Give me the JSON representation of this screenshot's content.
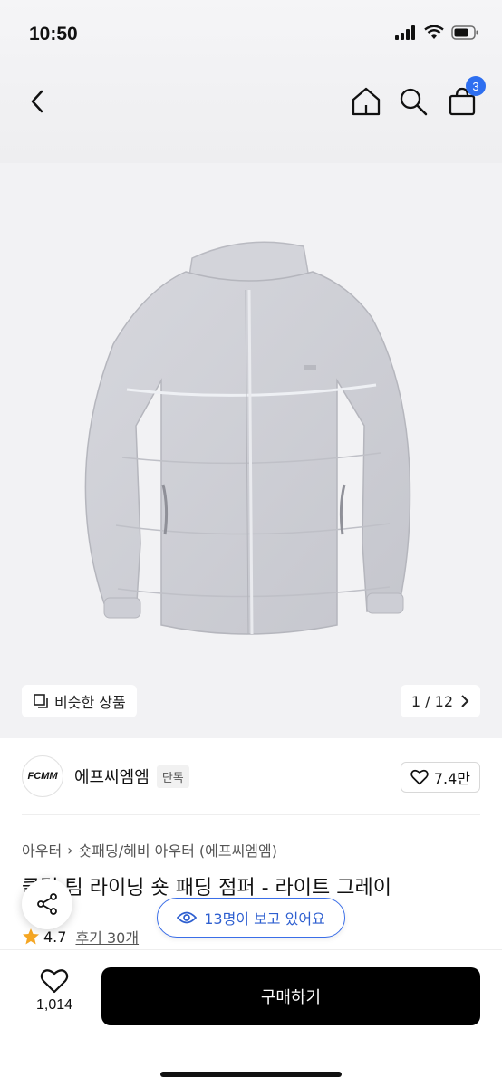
{
  "status": {
    "time": "10:50",
    "battery_icon": "battery-icon",
    "wifi_icon": "wifi-icon",
    "signal_icon": "signal-icon"
  },
  "nav": {
    "back_icon": "chevron-left-icon",
    "home_icon": "home-icon",
    "search_icon": "search-icon",
    "cart_icon": "shopping-bag-icon",
    "cart_count": "3",
    "accent": "#2e6ff0"
  },
  "gallery": {
    "similar_label": "비슷한 상품",
    "pager": "1 / 12"
  },
  "brand": {
    "logo_text": "FCMM",
    "name": "에프씨엠엠",
    "tag": "단독",
    "likes": "7.4만"
  },
  "breadcrumb": {
    "cat1": "아우터",
    "separator": "›",
    "cat2": "숏패딩/헤비 아우터 (에프씨엠엠)"
  },
  "product": {
    "title": "클럽 팀 라이닝 숏 패딩 점퍼 - 라이트 그레이"
  },
  "rating": {
    "score": "4.7",
    "reviews": "후기 30개",
    "star_color": "#f5a623"
  },
  "viewers": {
    "label": "13명이 보고 있어요"
  },
  "bottom": {
    "wish_count": "1,014",
    "buy_label": "구매하기"
  }
}
